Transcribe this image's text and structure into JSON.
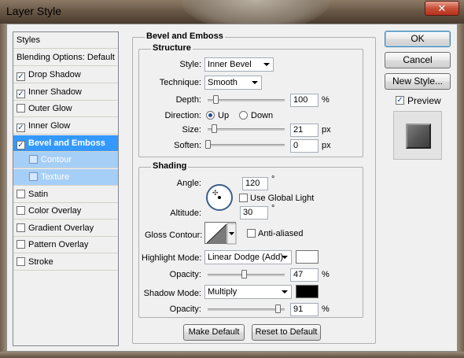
{
  "window": {
    "title": "Layer Style",
    "close_glyph": "✕"
  },
  "sidebar": {
    "header": "Styles",
    "blending": "Blending Options: Default",
    "items": [
      {
        "label": "Drop Shadow",
        "checked": true
      },
      {
        "label": "Inner Shadow",
        "checked": true
      },
      {
        "label": "Outer Glow",
        "checked": false
      },
      {
        "label": "Inner Glow",
        "checked": true
      },
      {
        "label": "Bevel and Emboss",
        "checked": true
      },
      {
        "label": "Contour",
        "checked": false
      },
      {
        "label": "Texture",
        "checked": false
      },
      {
        "label": "Satin",
        "checked": false
      },
      {
        "label": "Color Overlay",
        "checked": false
      },
      {
        "label": "Gradient Overlay",
        "checked": false
      },
      {
        "label": "Pattern Overlay",
        "checked": false
      },
      {
        "label": "Stroke",
        "checked": false
      }
    ],
    "check_glyph": "✓"
  },
  "panel": {
    "title": "Bevel and Emboss",
    "structure": {
      "title": "Structure",
      "style_label": "Style:",
      "style_value": "Inner Bevel",
      "technique_label": "Technique:",
      "technique_value": "Smooth",
      "depth_label": "Depth:",
      "depth_value": "100",
      "depth_unit": "%",
      "depth_level": 0.1,
      "direction_label": "Direction:",
      "direction_up": "Up",
      "direction_down": "Down",
      "direction_selected": "Up",
      "size_label": "Size:",
      "size_value": "21",
      "size_unit": "px",
      "size_level": 0.08,
      "soften_label": "Soften:",
      "soften_value": "0",
      "soften_unit": "px",
      "soften_level": 0.0
    },
    "shading": {
      "title": "Shading",
      "angle_label": "Angle:",
      "angle_value": "120",
      "degree_unit": "°",
      "global_light_label": "Use Global Light",
      "global_light_checked": false,
      "altitude_label": "Altitude:",
      "altitude_value": "30",
      "gloss_label": "Gloss Contour:",
      "anti_aliased_label": "Anti-aliased",
      "anti_aliased_checked": false,
      "highlight_mode_label": "Highlight Mode:",
      "highlight_mode_value": "Linear Dodge (Add)",
      "highlight_color": "#ffffff",
      "highlight_opacity_label": "Opacity:",
      "highlight_opacity_value": "47",
      "highlight_opacity_level": 0.47,
      "shadow_mode_label": "Shadow Mode:",
      "shadow_mode_value": "Multiply",
      "shadow_color": "#000000",
      "shadow_opacity_label": "Opacity:",
      "shadow_opacity_value": "91",
      "shadow_opacity_level": 0.91,
      "percent_unit": "%"
    },
    "make_default": "Make Default",
    "reset_default": "Reset to Default"
  },
  "actions": {
    "ok": "OK",
    "cancel": "Cancel",
    "new_style": "New Style...",
    "preview_label": "Preview",
    "preview_checked": true
  },
  "colors": {
    "selection": "#3399ff",
    "sub_selection": "#a6cff7"
  }
}
